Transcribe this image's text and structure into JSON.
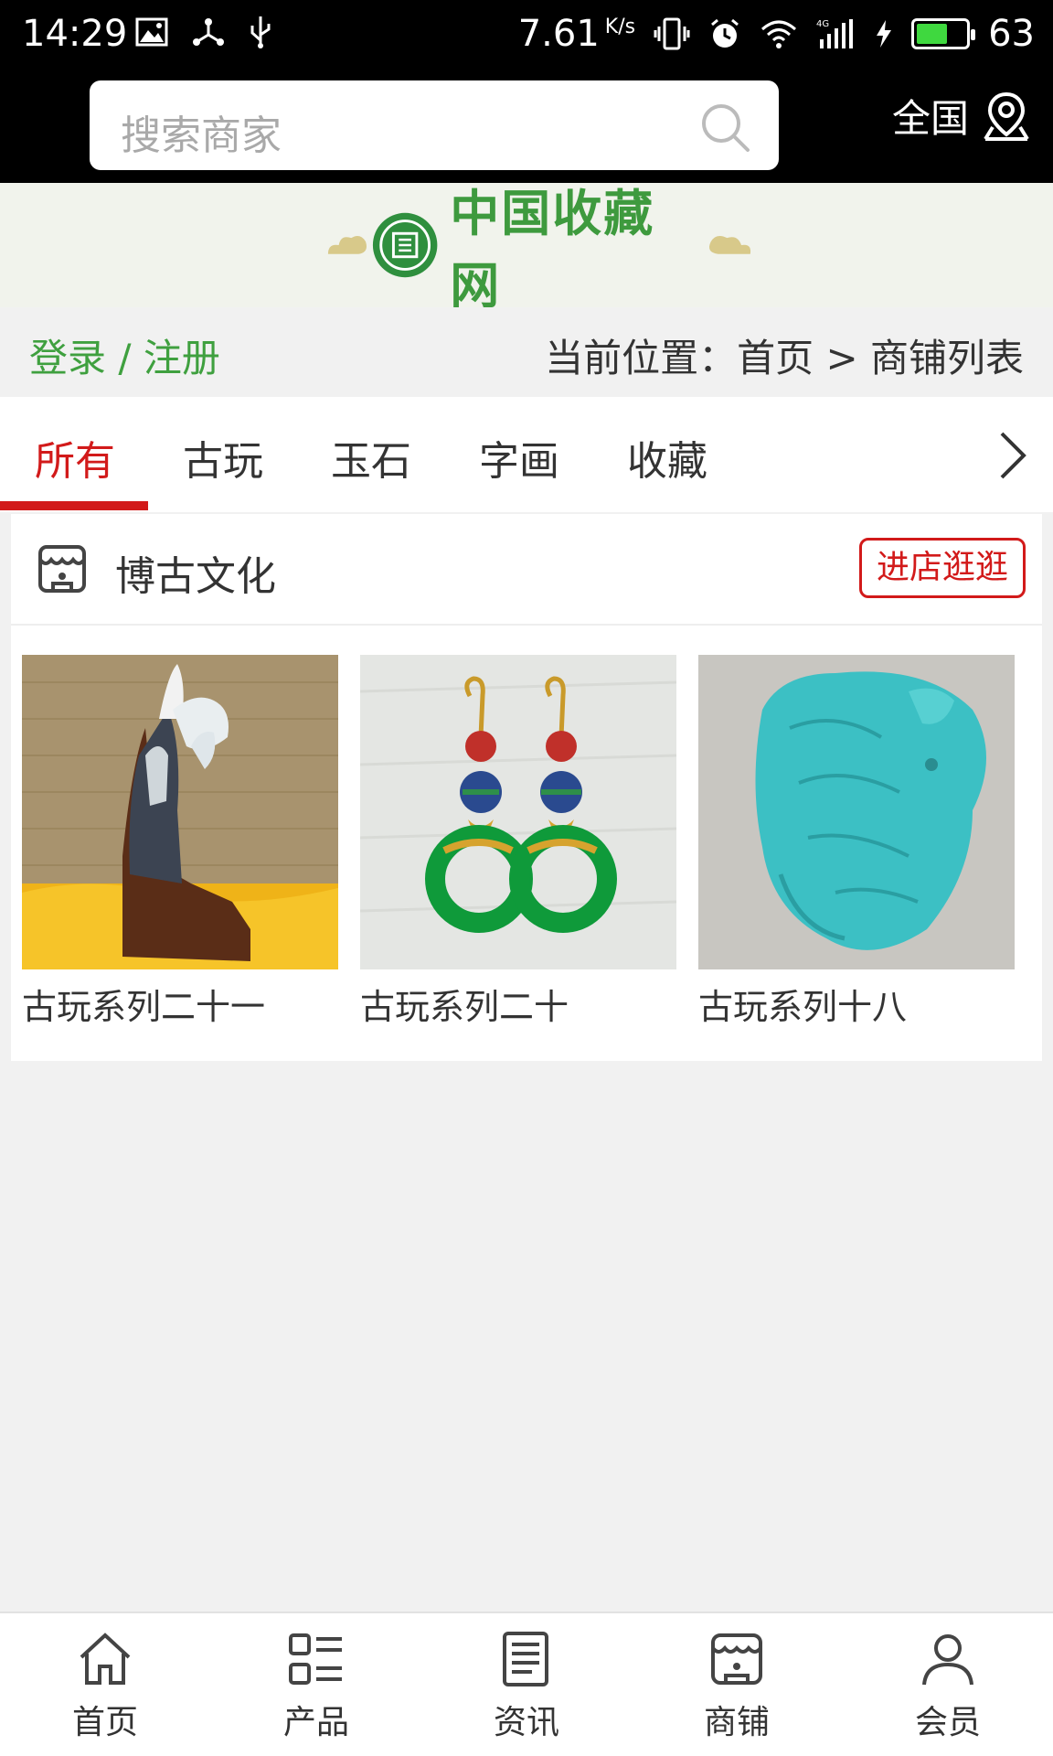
{
  "status_bar": {
    "time": "14:29",
    "speed": "7.61",
    "speed_unit": "K/s",
    "battery": "63",
    "battery_level": 0.63
  },
  "header": {
    "search_placeholder": "搜索商家",
    "region": "全国"
  },
  "login_bar": {
    "login": "登录 / 注册",
    "breadcrumb": "当前位置：首页 > 商铺列表"
  },
  "tabs": [
    {
      "label": "所有",
      "active": true
    },
    {
      "label": "古玩",
      "active": false
    },
    {
      "label": "玉石",
      "active": false
    },
    {
      "label": "字画",
      "active": false
    },
    {
      "label": "收藏",
      "active": false
    }
  ],
  "shop": {
    "name": "博古文化",
    "enter_label": "进店逛逛",
    "products": [
      {
        "title": "古玩系列二十一"
      },
      {
        "title": "古玩系列二十"
      },
      {
        "title": "古玩系列十八"
      }
    ]
  },
  "bottom_nav": [
    {
      "label": "首页",
      "icon": "home-icon"
    },
    {
      "label": "产品",
      "icon": "grid-list-icon"
    },
    {
      "label": "资讯",
      "icon": "news-icon"
    },
    {
      "label": "商铺",
      "icon": "store-icon"
    },
    {
      "label": "会员",
      "icon": "user-icon"
    }
  ],
  "colors": {
    "accent": "#d21a1a",
    "login_green": "#3fa03f"
  }
}
